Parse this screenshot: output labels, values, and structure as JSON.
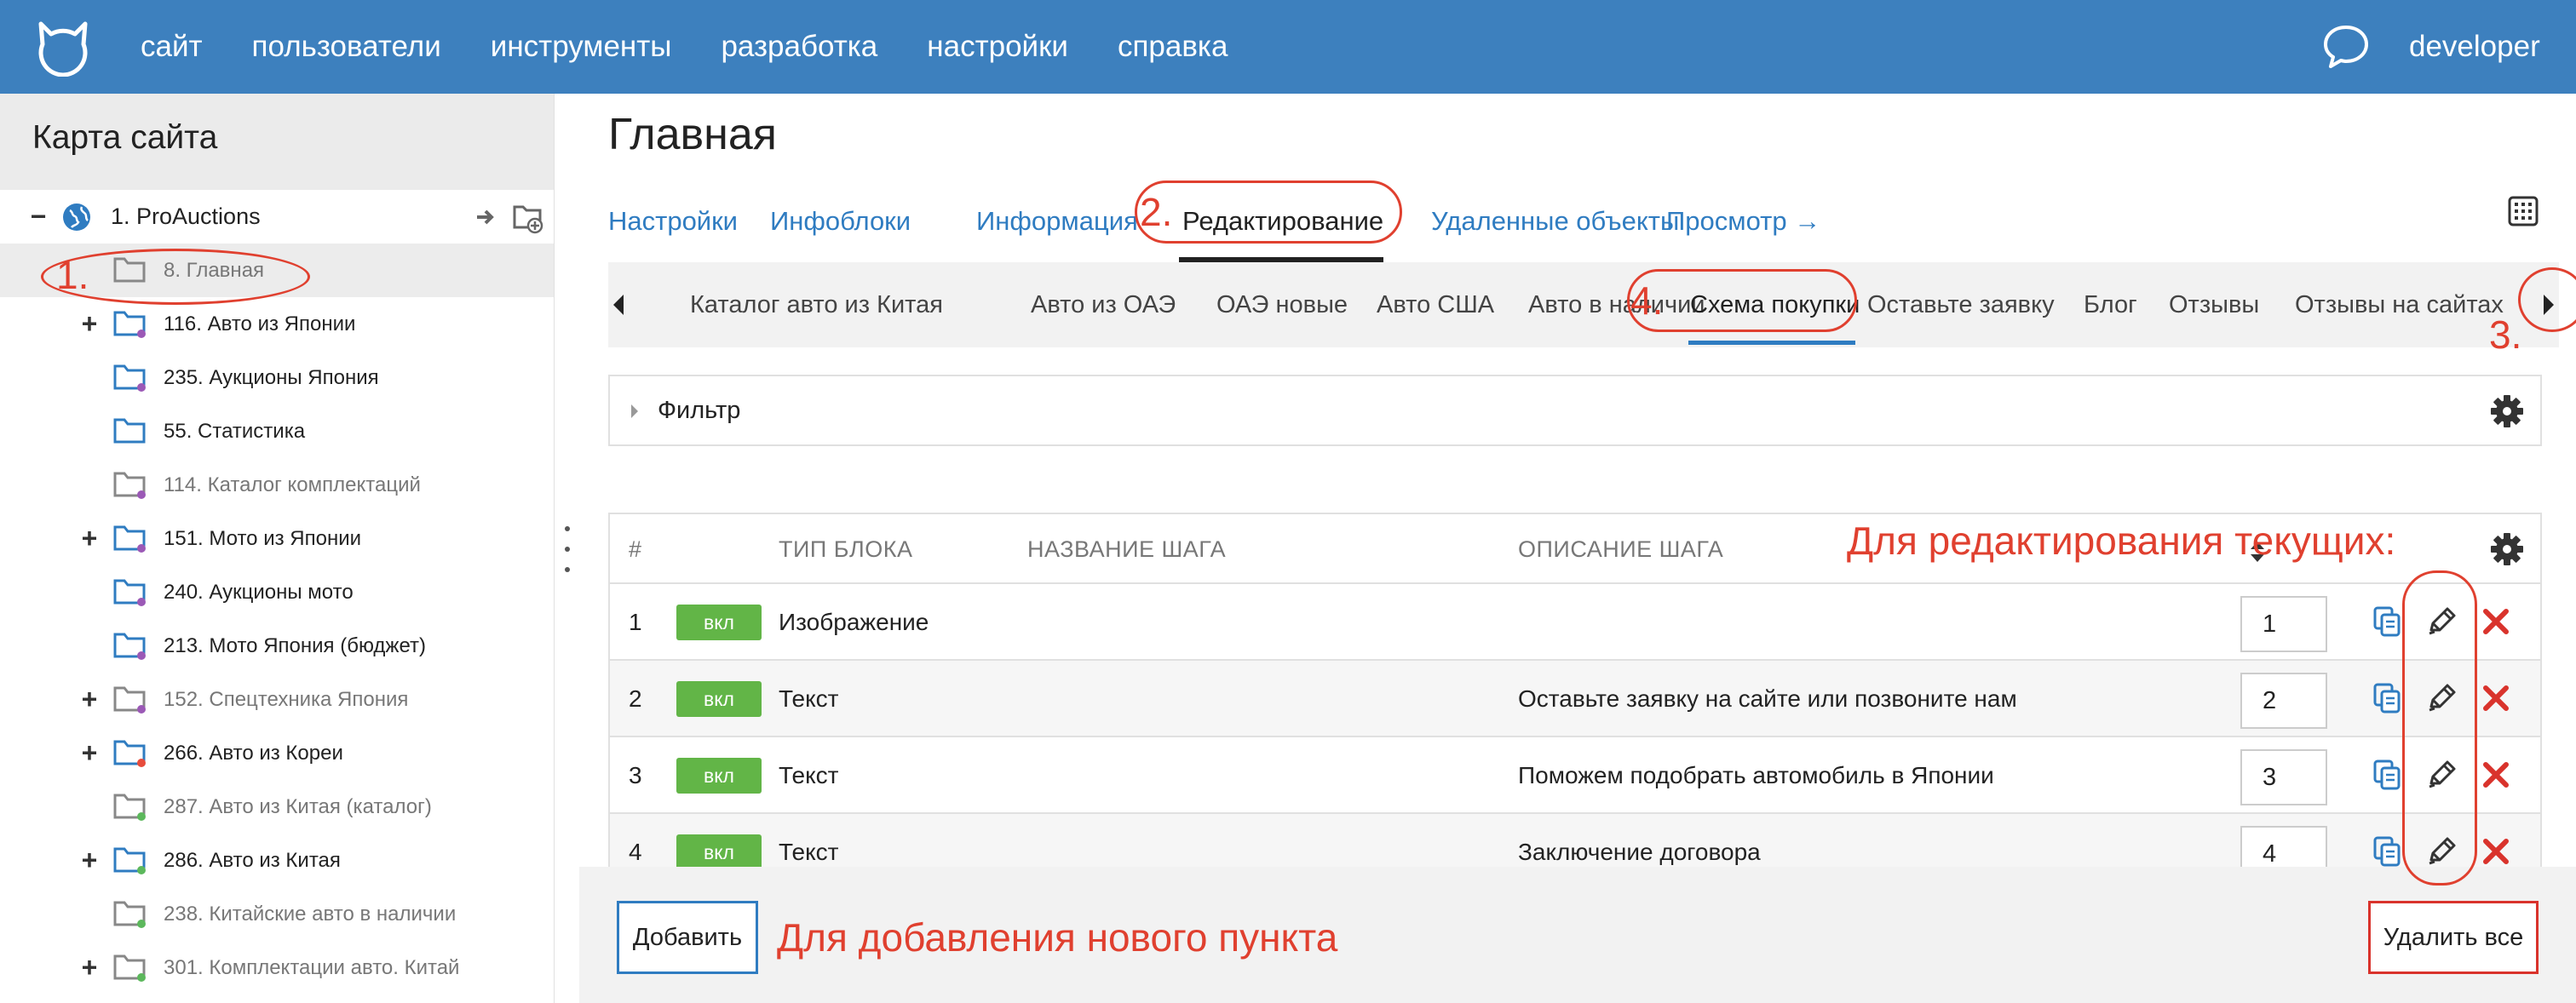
{
  "topbar": {
    "nav": [
      "сайт",
      "пользователи",
      "инструменты",
      "разработка",
      "настройки",
      "справка"
    ],
    "user": "developer"
  },
  "sidebar": {
    "title": "Карта сайта",
    "root": "1. ProAuctions",
    "items": [
      {
        "label": "8. Главная",
        "toggle": "",
        "active": false,
        "dot": ""
      },
      {
        "label": "116. Авто из Японии",
        "toggle": "+",
        "active": true,
        "dot": "#9b59b6"
      },
      {
        "label": "235. Аукционы Япония",
        "toggle": "",
        "active": true,
        "dot": "#9b59b6"
      },
      {
        "label": "55. Статистика",
        "toggle": "",
        "active": true,
        "dot": ""
      },
      {
        "label": "114. Каталог комплектаций",
        "toggle": "",
        "active": false,
        "dot": "#9b59b6"
      },
      {
        "label": "151. Мото из Японии",
        "toggle": "+",
        "active": true,
        "dot": "#9b59b6"
      },
      {
        "label": "240. Аукционы мото",
        "toggle": "",
        "active": true,
        "dot": "#9b59b6"
      },
      {
        "label": "213. Мото Япония (бюджет)",
        "toggle": "",
        "active": true,
        "dot": "#9b59b6"
      },
      {
        "label": "152. Спецтехника Япония",
        "toggle": "+",
        "active": false,
        "dot": "#9b59b6"
      },
      {
        "label": "266. Авто из Кореи",
        "toggle": "+",
        "active": true,
        "dot": "#e74c3c"
      },
      {
        "label": "287. Авто из Китая (каталог)",
        "toggle": "",
        "active": false,
        "dot": "#5cb85c"
      },
      {
        "label": "286. Авто из Китая",
        "toggle": "+",
        "active": true,
        "dot": "#5cb85c"
      },
      {
        "label": "238. Китайские авто в наличии",
        "toggle": "",
        "active": false,
        "dot": "#5cb85c"
      },
      {
        "label": "301. Комплектации авто. Китай",
        "toggle": "+",
        "active": false,
        "dot": "#5cb85c"
      }
    ]
  },
  "page": {
    "title": "Главная",
    "tabs": [
      "Настройки",
      "Инфоблоки",
      "Информация",
      "Редактирование",
      "Удаленные объекты",
      "Просмотр →"
    ],
    "subtabs": [
      "Каталог авто из Китая",
      "Авто из ОАЭ",
      "ОАЭ новые",
      "Авто США",
      "Авто в наличии",
      "Схема покупки",
      "Оставьте заявку",
      "Блог",
      "Отзывы",
      "Отзывы на сайтах"
    ],
    "filter_label": "Фильтр"
  },
  "table": {
    "headers": [
      "#",
      "ТИП БЛОКА",
      "НАЗВАНИЕ ШАГА",
      "ОПИСАНИЕ ШАГА"
    ],
    "rows": [
      {
        "num": "1",
        "badge": "вкл",
        "type": "Изображение",
        "desc": "",
        "order": "1"
      },
      {
        "num": "2",
        "badge": "вкл",
        "type": "Текст",
        "desc": "Оставьте заявку на сайте или позвоните нам",
        "order": "2"
      },
      {
        "num": "3",
        "badge": "вкл",
        "type": "Текст",
        "desc": "Поможем подобрать автомобиль в Японии",
        "order": "3"
      },
      {
        "num": "4",
        "badge": "вкл",
        "type": "Текст",
        "desc": "Заключение договора",
        "order": "4"
      }
    ]
  },
  "footer": {
    "add": "Добавить",
    "delete_all": "Удалить все"
  },
  "annotations": {
    "n1": "1.",
    "n2": "2.",
    "n3": "3.",
    "n4": "4.",
    "edit_note": "Для редактирования текущих:",
    "add_note": "Для добавления нового пункта"
  },
  "colors": {
    "topbar": "#3d80be",
    "link": "#2f7cc1",
    "badge": "#62b547",
    "annotation": "#e0402f"
  }
}
